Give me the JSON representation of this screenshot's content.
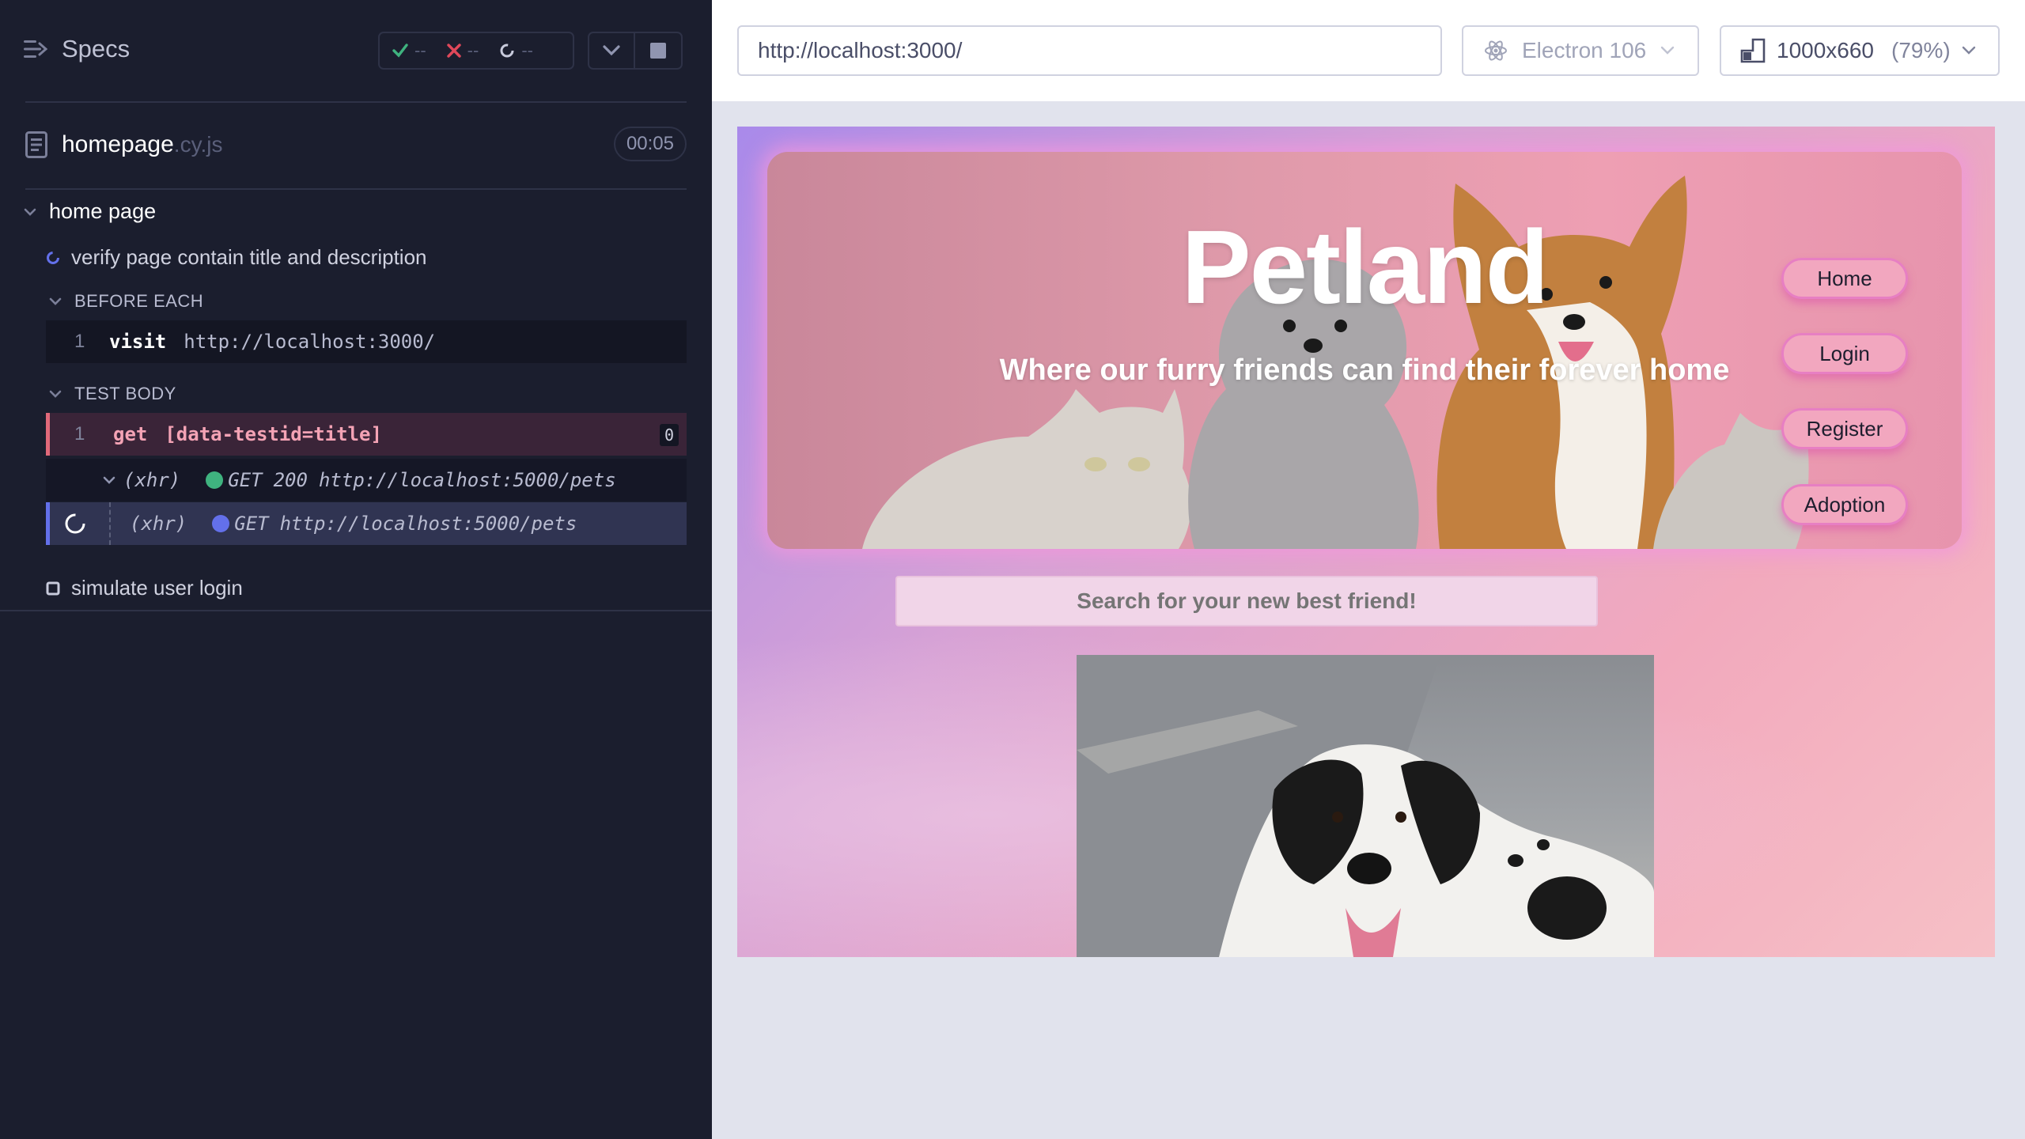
{
  "header": {
    "specs_label": "Specs",
    "passed": "--",
    "failed": "--",
    "pending": "--"
  },
  "file": {
    "name": "homepage",
    "ext": ".cy.js",
    "duration": "00:05"
  },
  "suite": {
    "title": "home page",
    "tests": [
      {
        "title": "verify page contain title and description",
        "before_each_label": "BEFORE EACH",
        "before_each_commands": [
          {
            "number": "1",
            "name": "visit",
            "message": "http://localhost:3000/"
          }
        ],
        "test_body_label": "TEST BODY",
        "test_body_commands": [
          {
            "number": "1",
            "name": "get",
            "message": "[data-testid=title]",
            "count": "0"
          }
        ],
        "xhr": [
          {
            "type": "(xhr)",
            "method": "GET",
            "status": "200",
            "url": "http://localhost:5000/pets",
            "dot_color": "#3fb37f"
          },
          {
            "type": "(xhr)",
            "method": "GET",
            "status": "",
            "url": "http://localhost:5000/pets",
            "dot_color": "#6370ea"
          }
        ]
      },
      {
        "title": "simulate user login"
      }
    ]
  },
  "browser": {
    "url": "http://localhost:3000/",
    "browser_name": "Electron 106",
    "viewport": "1000x660",
    "zoom": "(79%)"
  },
  "app": {
    "title": "Petland",
    "subtitle": "Where our furry friends can find their forever home",
    "nav": [
      "Home",
      "Login",
      "Register",
      "Adoption"
    ],
    "search_placeholder": "Search for your new best friend!"
  },
  "colors": {
    "sidebar_bg": "#1b1e2e",
    "passed": "#3fb37f",
    "failed": "#e0485a",
    "accent": "#6370ea",
    "hero_pink": "#ee9fb3",
    "nav_border": "#e77fc3"
  },
  "icons": [
    "specs-icon",
    "check-icon",
    "x-icon",
    "spinner-icon",
    "chevron-down-icon",
    "stop-icon",
    "file-icon",
    "electron-icon",
    "viewport-icon"
  ]
}
